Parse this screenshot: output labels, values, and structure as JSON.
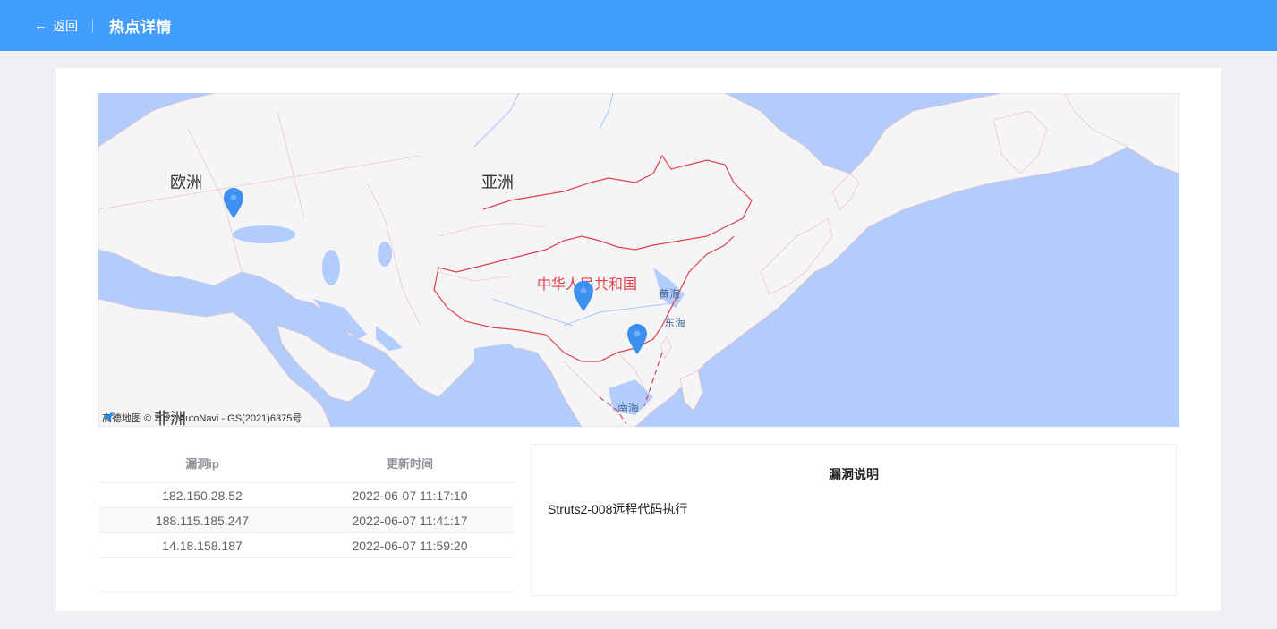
{
  "header": {
    "back_label": "返回",
    "title": "热点详情"
  },
  "map": {
    "labels": {
      "europe": "欧洲",
      "asia": "亚洲",
      "africa": "非洲",
      "china": "中华人民共和国",
      "yellow_sea": "黄海",
      "east_sea": "东海",
      "south_sea": "南海"
    },
    "attribution": "高德地图 © 2022 AutoNavi - GS(2021)6375号",
    "marker_color": "#3d8ff0"
  },
  "table": {
    "columns": [
      "漏洞ip",
      "更新时间"
    ],
    "rows": [
      {
        "ip": "182.150.28.52",
        "time": "2022-06-07 11:17:10"
      },
      {
        "ip": "188.115.185.247",
        "time": "2022-06-07 11:41:17"
      },
      {
        "ip": "14.18.158.187",
        "time": "2022-06-07 11:59:20"
      }
    ]
  },
  "description": {
    "title": "漏洞说明",
    "text": "Struts2-008远程代码执行"
  },
  "colors": {
    "header_bg": "#429efe",
    "page_bg": "#eef0f4",
    "ocean": "#b2cdfc",
    "land": "#f5f5f7",
    "border": "#e2414b"
  }
}
